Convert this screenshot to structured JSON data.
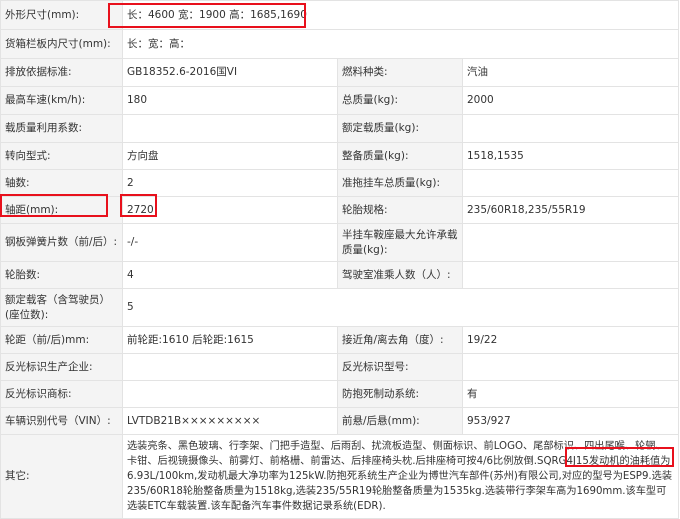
{
  "rows": [
    {
      "l1": "外形尺寸(mm):",
      "v1": "长：4600 宽：1900 高：1685,1690"
    },
    {
      "l1": "货箱栏板内尺寸(mm):",
      "v1": "长：宽：高："
    },
    {
      "l1": "排放依据标准:",
      "v1": "GB18352.6-2016国VI",
      "l2": "燃料种类:",
      "v2": "汽油"
    },
    {
      "l1": "最高车速(km/h):",
      "v1": "180",
      "l2": "总质量(kg):",
      "v2": "2000"
    },
    {
      "l1": "载质量利用系数:",
      "v1": "",
      "l2": "额定载质量(kg):",
      "v2": ""
    },
    {
      "l1": "转向型式:",
      "v1": "方向盘",
      "l2": "整备质量(kg):",
      "v2": "1518,1535"
    },
    {
      "l1": "轴数:",
      "v1": "2",
      "l2": "准拖挂车总质量(kg):",
      "v2": ""
    },
    {
      "l1": "轴距(mm):",
      "v1": "2720",
      "l2": "轮胎规格:",
      "v2": "235/60R18,235/55R19"
    },
    {
      "l1": "钢板弹簧片数（前/后）:",
      "v1": "-/-",
      "l2": "半挂车鞍座最大允许承载质量(kg):",
      "v2": ""
    },
    {
      "l1": "轮胎数:",
      "v1": "4",
      "l2": "驾驶室准乘人数（人）:",
      "v2": ""
    },
    {
      "l1": "额定载客（含驾驶员）(座位数):",
      "v1": "5"
    },
    {
      "l1": "轮距（前/后)mm:",
      "v1": "前轮距:1610 后轮距:1615",
      "l2": "接近角/离去角（度）:",
      "v2": "19/22"
    },
    {
      "l1": "反光标识生产企业:",
      "v1": "",
      "l2": "反光标识型号:",
      "v2": ""
    },
    {
      "l1": "反光标识商标:",
      "v1": "",
      "l2": "防抱死制动系统:",
      "v2": "有"
    },
    {
      "l1": "车辆识别代号（VIN）:",
      "v1": "LVTDB21B×××××××××",
      "l2": "前悬/后悬(mm):",
      "v2": "953/927"
    }
  ],
  "other": {
    "label": "其它:",
    "text": "选装亮条、黑色玻璃、行李架、门把手造型、后雨刮、扰流板造型、侧面标识、前LOGO、尾部标识、四出尾喉、轮辋、卡钳、后视镜摄像头、前雾灯、前格栅、前雷达、后排座椅头枕.后排座椅可按4/6比例放倒.SQRG4J15发动机的油耗值为6.93L/100km,发动机最大净功率为125kW.防抱死系统生产企业为博世汽车部件(苏州)有限公司,对应的型号为ESP9.选装235/60R18轮胎整备质量为1518kg,选装235/55R19轮胎整备质量为1535kg.选装带行李架车高为1690mm.该车型可选装ETC车载装置.该车配备汽车事件数据记录系统(EDR)."
  },
  "highlight_color": "#e8101c"
}
